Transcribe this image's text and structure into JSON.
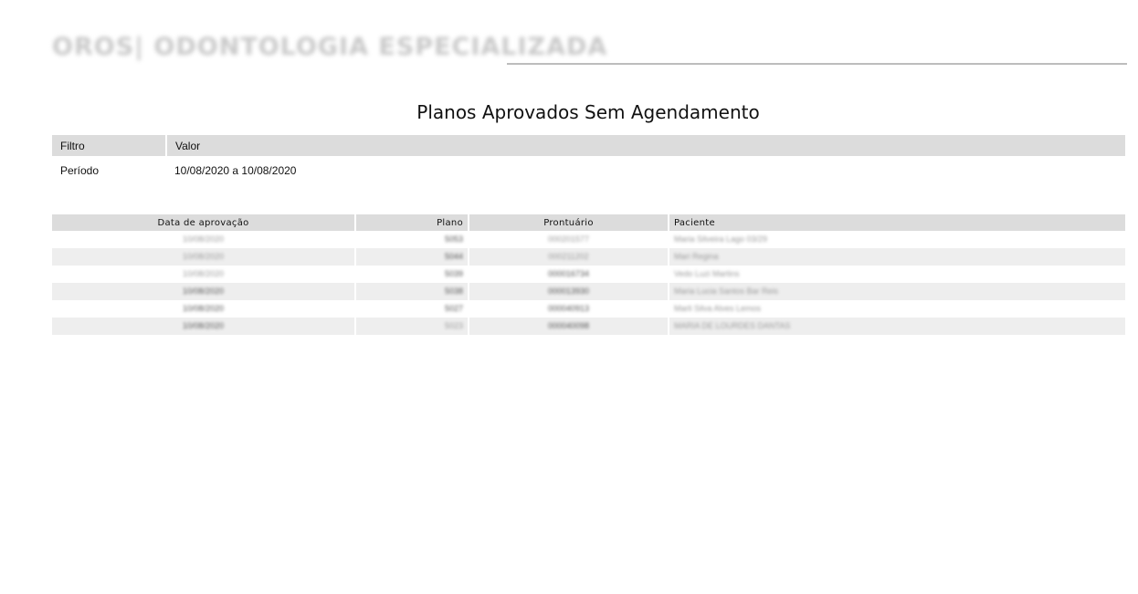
{
  "header": {
    "clinic_name": "OROS| ODONTOLOGIA ESPECIALIZADA"
  },
  "report": {
    "title": "Planos Aprovados Sem Agendamento"
  },
  "filter_table": {
    "columns": [
      "Filtro",
      "Valor"
    ],
    "rows": [
      {
        "filter": "Período",
        "value": "10/08/2020 a 10/08/2020"
      }
    ]
  },
  "results_table": {
    "columns": [
      "Data de aprovação",
      "Plano",
      "Prontuário",
      "Paciente"
    ],
    "rows": [
      {
        "date": "10/08/2020",
        "plan": "5053",
        "record": "000201577",
        "patient": "Maria Silveira Lago 03/29"
      },
      {
        "date": "10/08/2020",
        "plan": "5044",
        "record": "000211202",
        "patient": "Mari Regina"
      },
      {
        "date": "10/08/2020",
        "plan": "5039",
        "record": "000016734",
        "patient": "Vedo Luzi Martins"
      },
      {
        "date": "10/08/2020",
        "plan": "5038",
        "record": "000013930",
        "patient": "Maria Lucia Santos Bar Reis"
      },
      {
        "date": "10/08/2020",
        "plan": "5027",
        "record": "000040913",
        "patient": "Marli Silva Alves Lemos"
      },
      {
        "date": "10/08/2020",
        "plan": "5023",
        "record": "000040098",
        "patient": "MARIA DE LOURDES DANTAS"
      }
    ]
  }
}
